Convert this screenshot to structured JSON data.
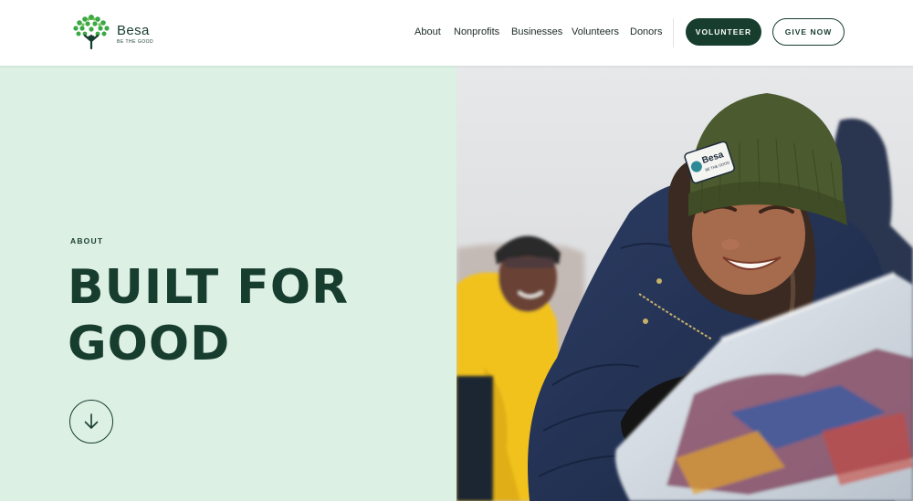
{
  "brand": {
    "name": "Besa",
    "tagline": "BE THE GOOD"
  },
  "nav": {
    "items": [
      {
        "label": "About"
      },
      {
        "label": "Nonprofits"
      },
      {
        "label": "Businesses"
      },
      {
        "label": "Volunteers"
      },
      {
        "label": "Donors"
      }
    ]
  },
  "actions": {
    "volunteer_label": "VOLUNTEER",
    "give_label": "GIVE NOW"
  },
  "hero": {
    "eyebrow": "ABOUT",
    "title_line1": "BUILT FOR",
    "title_line2": "GOOD",
    "scroll_icon": "arrow-down-icon"
  },
  "photo": {
    "hat_brand": "Besa",
    "hat_tagline": "BE THE GOOD"
  },
  "colors": {
    "brand_dark_green": "#173d2f",
    "hero_mint": "#dcf0e4",
    "logo_leaf_green": "#3aa845"
  }
}
